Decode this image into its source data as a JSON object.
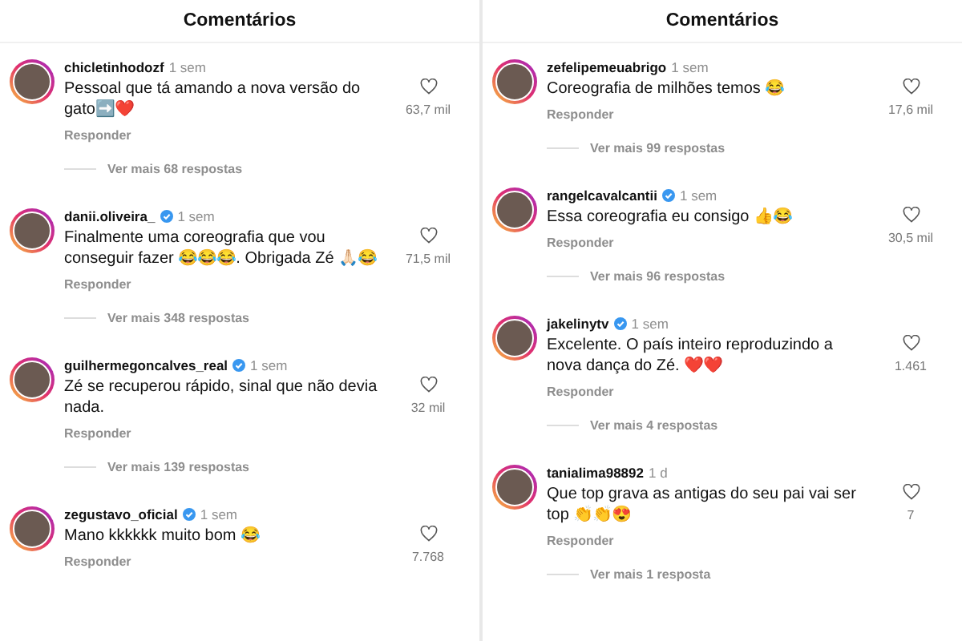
{
  "panels": [
    {
      "title": "Comentários",
      "comments": [
        {
          "username": "chicletinhodozf",
          "verified": false,
          "time": "1 sem",
          "text": "Pessoal que tá amando a nova versão do gato➡️❤️",
          "reply_label": "Responder",
          "likes": "63,7 mil",
          "more_replies": "Ver mais 68 respostas"
        },
        {
          "username": "danii.oliveira_",
          "verified": true,
          "time": "1 sem",
          "text": "Finalmente uma coreografia que vou conseguir fazer 😂😂😂. Obrigada Zé 🙏🏻😂",
          "reply_label": "Responder",
          "likes": "71,5 mil",
          "more_replies": "Ver mais 348 respostas"
        },
        {
          "username": "guilhermegoncalves_real",
          "verified": true,
          "time": "1 sem",
          "text": "Zé se recuperou rápido, sinal que não devia nada.",
          "reply_label": "Responder",
          "likes": "32 mil",
          "more_replies": "Ver mais 139 respostas"
        },
        {
          "username": "zegustavo_oficial",
          "verified": true,
          "time": "1 sem",
          "text": "Mano kkkkkk muito bom 😂",
          "reply_label": "Responder",
          "likes": "7.768"
        }
      ]
    },
    {
      "title": "Comentários",
      "comments": [
        {
          "username": "zefelipemeuabrigo",
          "verified": false,
          "time": "1 sem",
          "text": "Coreografia de milhões temos 😂",
          "reply_label": "Responder",
          "likes": "17,6 mil",
          "more_replies": "Ver mais 99 respostas"
        },
        {
          "username": "rangelcavalcantii",
          "verified": true,
          "time": "1 sem",
          "text": "Essa coreografia eu consigo 👍😂",
          "reply_label": "Responder",
          "likes": "30,5 mil",
          "more_replies": "Ver mais 96 respostas"
        },
        {
          "username": "jakelinytv",
          "verified": true,
          "time": "1 sem",
          "text": "Excelente. O país inteiro reproduzindo a nova dança do Zé. ❤️❤️",
          "reply_label": "Responder",
          "likes": "1.461",
          "more_replies": "Ver mais 4 respostas"
        },
        {
          "username": "tanialima98892",
          "verified": false,
          "time": "1 d",
          "text": "Que top grava as antigas do seu pai vai ser top 👏👏😍",
          "reply_label": "Responder",
          "likes": "7",
          "more_replies": "Ver mais 1 resposta"
        }
      ]
    }
  ]
}
